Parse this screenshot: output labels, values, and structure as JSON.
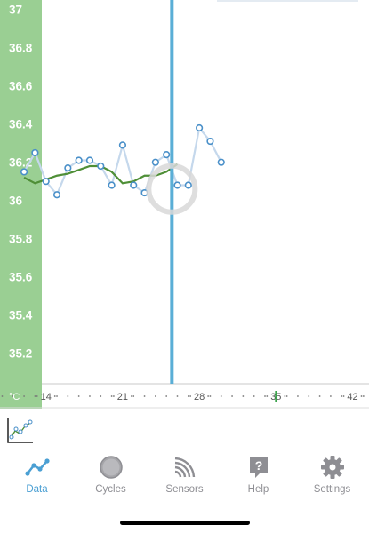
{
  "chart_data": {
    "type": "line",
    "y_unit_label": "°C",
    "yticks": [
      37,
      36.8,
      36.6,
      36.4,
      36.2,
      36,
      35.8,
      35.6,
      35.4,
      35.2
    ],
    "ylim": [
      35.04,
      37.05
    ],
    "xticks": [
      14,
      21,
      28,
      35,
      42
    ],
    "xlim": [
      9.8,
      43.5
    ],
    "today_marker_x": 35,
    "selected_x": 25.5,
    "series": [
      {
        "x": [
          12,
          13,
          14,
          15,
          16,
          17,
          18,
          19,
          20,
          21,
          22,
          23,
          24,
          25,
          26,
          27,
          28,
          29
        ],
        "values": [
          36.15,
          36.25,
          36.1,
          36.03,
          36.17,
          36.21,
          36.21,
          36.18,
          36.08,
          36.29,
          36.08,
          36.04,
          36.2,
          36.24,
          36.08,
          36.08,
          36.38,
          36.31
        ]
      },
      {
        "x": [
          12,
          13,
          14,
          15,
          16,
          17,
          18,
          19,
          20,
          21,
          22,
          23,
          24,
          25,
          26
        ],
        "values": [
          36.12,
          36.09,
          36.11,
          36.13,
          36.14,
          36.16,
          36.18,
          36.18,
          36.15,
          36.09,
          36.1,
          36.13,
          36.13,
          36.15,
          36.19
        ]
      }
    ],
    "extra_point": {
      "x": 30,
      "value": 36.2
    },
    "colors": {
      "axis_band": "#9acf93",
      "raw_line": "#c5d8ec",
      "point_stroke": "#4a90c9",
      "smooth_line": "#4f8f37",
      "cursor": "#5aaed6",
      "today_tick": "#3aa34b",
      "selector_ring": "#d8d8d8"
    }
  },
  "tabs": [
    {
      "label": "Data",
      "icon": "data-line-icon",
      "active": true
    },
    {
      "label": "Cycles",
      "icon": "cycles-circle-icon",
      "active": false
    },
    {
      "label": "Sensors",
      "icon": "sensors-signal-icon",
      "active": false
    },
    {
      "label": "Help",
      "icon": "help-question-icon",
      "active": false
    },
    {
      "label": "Settings",
      "icon": "settings-gear-icon",
      "active": false
    }
  ]
}
